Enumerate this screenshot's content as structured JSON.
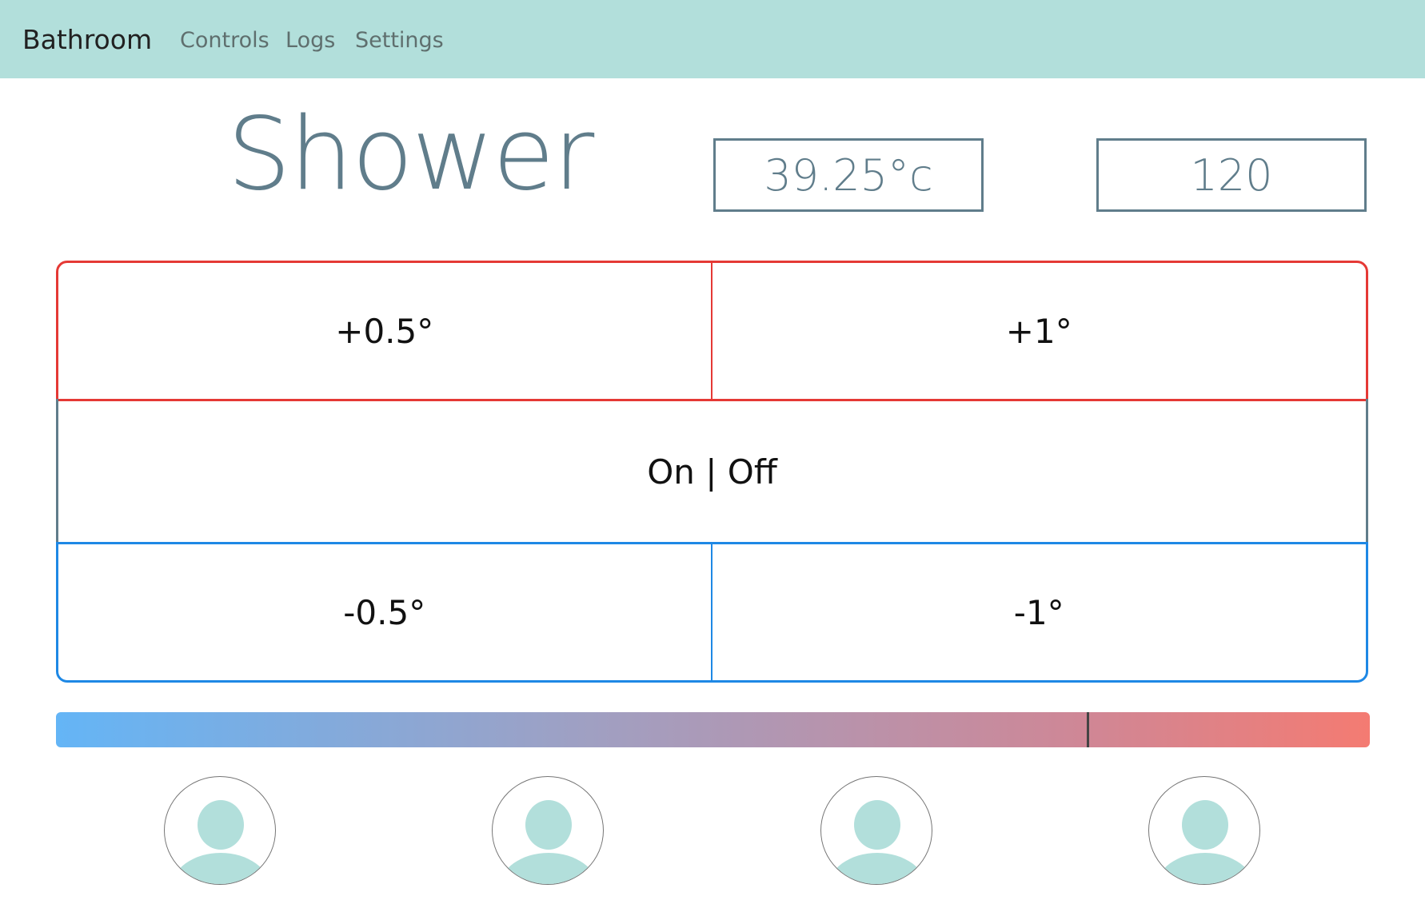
{
  "navbar": {
    "brand": "Bathroom",
    "links": [
      "Controls",
      "Logs",
      "Settings"
    ]
  },
  "device": {
    "title": "Shower",
    "temperature_display": "39.25°c",
    "secondary_display": "120"
  },
  "controls": {
    "hot_small": "+0.5°",
    "hot_large": "+1°",
    "power": "On | Off",
    "cold_small": "-0.5°",
    "cold_large": "-1°"
  },
  "temperature_slider": {
    "position_fraction": 0.785,
    "gradient_start": "#64b5f6",
    "gradient_end": "#f47b72"
  },
  "users": [
    {
      "icon": "user-avatar-icon"
    },
    {
      "icon": "user-avatar-icon"
    },
    {
      "icon": "user-avatar-icon"
    },
    {
      "icon": "user-avatar-icon"
    }
  ],
  "colors": {
    "navbar_bg": "#b2dfdb",
    "accent": "#607d8b",
    "hot": "#e53935",
    "cold": "#1e88e5",
    "avatar_fill": "#b2dfdb"
  }
}
